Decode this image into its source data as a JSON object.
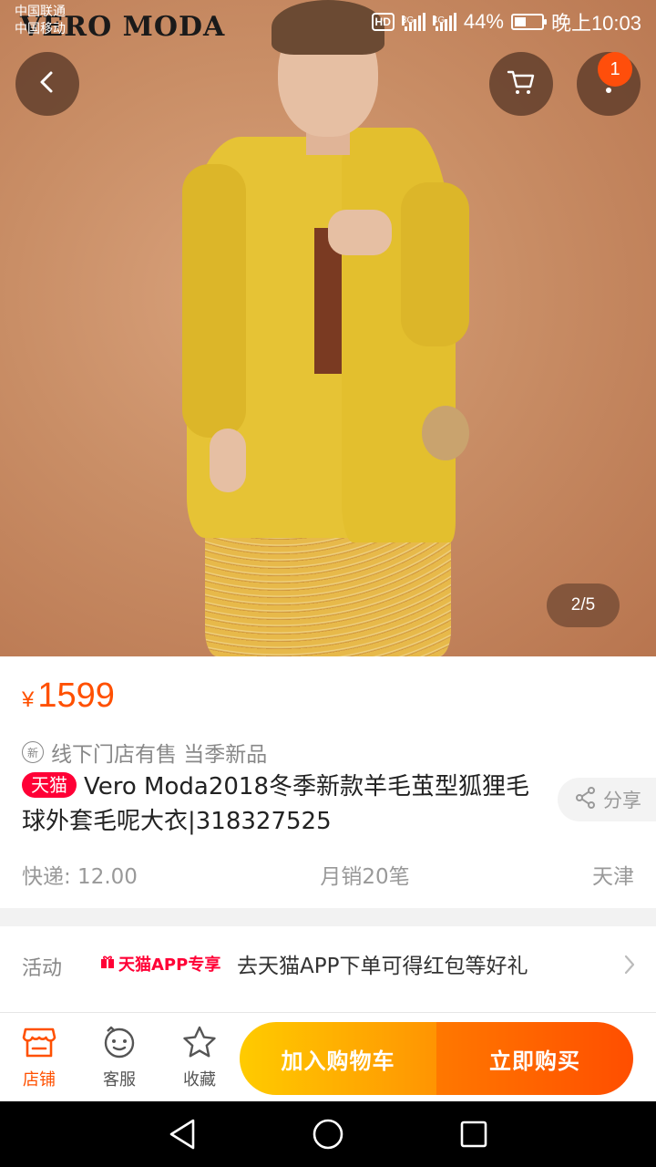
{
  "status_bar": {
    "carrier_1": "中国联通",
    "carrier_2": "中国移动",
    "hd": "HD",
    "net_1": "3G",
    "net_2": "4G",
    "battery_percent": "44%",
    "battery_level": 0.44,
    "time": "晚上10:03"
  },
  "hero": {
    "brand_watermark": "VERO MODA",
    "page_counter": "2/5",
    "notification_count": "1",
    "image_index": 2,
    "image_total": 5
  },
  "product": {
    "price_symbol": "¥",
    "price": "1599",
    "new_icon_text": "新",
    "tags_text": "线下门店有售 当季新品",
    "tmall_badge": "天猫",
    "title": "Vero Moda2018冬季新款羊毛茧型狐狸毛球外套毛呢大衣|318327525",
    "share_label": "分享",
    "shipping": "快递: 12.00",
    "monthly_sales": "月销20笔",
    "location": "天津"
  },
  "activity": {
    "label": "活动",
    "tag": "天猫APP专享",
    "text": "去天猫APP下单可得红包等好礼"
  },
  "bottom_bar": {
    "store_label": "店铺",
    "service_label": "客服",
    "favorite_label": "收藏",
    "add_to_cart_label": "加入购物车",
    "buy_now_label": "立即购买"
  },
  "colors": {
    "accent_orange": "#ff5000",
    "tmall_red": "#ff0036",
    "cart_gradient_start": "#ffcb00",
    "buy_gradient_end": "#ff4e00"
  },
  "icons": [
    "back-icon",
    "cart-icon",
    "more-icon",
    "share-icon",
    "store-icon",
    "service-icon",
    "star-icon",
    "chevron-right-icon",
    "nav-back-icon",
    "nav-home-icon",
    "nav-recent-icon"
  ]
}
